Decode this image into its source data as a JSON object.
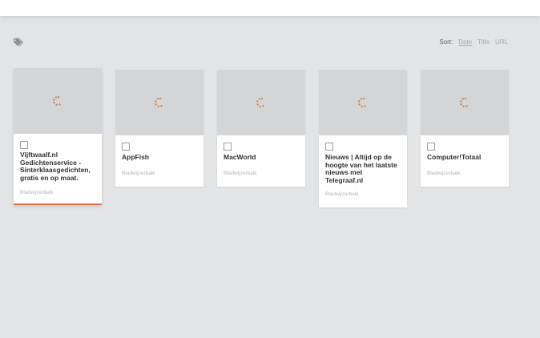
{
  "toolbar": {
    "tags_icon": "tags-icon",
    "sort": {
      "label": "Sort:",
      "options": [
        "Date",
        "Title",
        "URL"
      ],
      "active": "Date"
    }
  },
  "bookmarks": [
    {
      "title": "Vijftwaalf.nl Gedichtenservice - Sinterklaasgedichten, gratis en op maat.",
      "folder": "Bladwijzerbalk",
      "selected": true
    },
    {
      "title": "AppFish",
      "folder": "Bladwijzerbalk",
      "selected": false
    },
    {
      "title": "MacWorld",
      "folder": "Bladwijzerbalk",
      "selected": false
    },
    {
      "title": "Nieuws | Altijd op de hoogte van het laatste nieuws met Telegraaf.nl",
      "folder": "Bladwijzerbalk",
      "selected": false
    },
    {
      "title": "Computer!Totaal",
      "folder": "Bladwijzerbalk",
      "selected": false
    }
  ],
  "colors": {
    "accent": "#e2734d",
    "background": "#e3e4e5",
    "thumb": "#d3d5d7"
  }
}
